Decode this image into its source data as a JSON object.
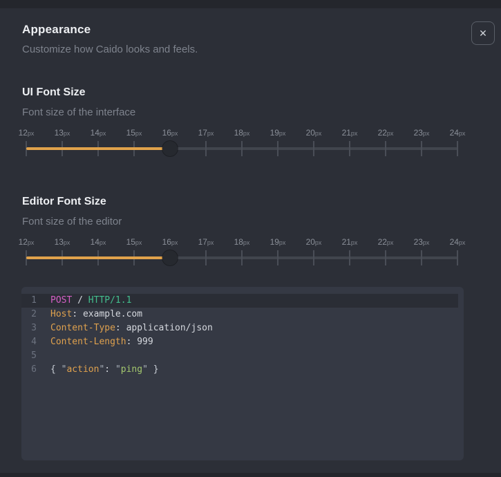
{
  "dialog": {
    "title": "Appearance",
    "subtitle": "Customize how Caido looks and feels.",
    "close_glyph": "✕"
  },
  "sections": [
    {
      "heading": "UI Font Size",
      "description": "Font size of the interface"
    },
    {
      "heading": "Editor Font Size",
      "description": "Font size of the editor"
    }
  ],
  "slider_scale": {
    "min": 12,
    "max": 24,
    "unit": "px",
    "ticks": [
      12,
      13,
      14,
      15,
      16,
      17,
      18,
      19,
      20,
      21,
      22,
      23,
      24
    ]
  },
  "sliders": [
    {
      "name": "ui-font-size",
      "value": 16
    },
    {
      "name": "editor-font-size",
      "value": 16
    }
  ],
  "editor_preview": {
    "lines": [
      {
        "number": 1,
        "active": true,
        "segments": [
          {
            "text": "POST",
            "type": "method"
          },
          {
            "text": " ",
            "type": "plain"
          },
          {
            "text": "/",
            "type": "plain"
          },
          {
            "text": " ",
            "type": "plain"
          },
          {
            "text": "HTTP/1.1",
            "type": "version"
          }
        ]
      },
      {
        "number": 2,
        "active": false,
        "segments": [
          {
            "text": "Host",
            "type": "header_name"
          },
          {
            "text": ": ",
            "type": "plain"
          },
          {
            "text": "example.com",
            "type": "plain"
          }
        ]
      },
      {
        "number": 3,
        "active": false,
        "segments": [
          {
            "text": "Content-Type",
            "type": "header_name"
          },
          {
            "text": ": ",
            "type": "plain"
          },
          {
            "text": "application/json",
            "type": "plain"
          }
        ]
      },
      {
        "number": 4,
        "active": false,
        "segments": [
          {
            "text": "Content-Length",
            "type": "header_name"
          },
          {
            "text": ": ",
            "type": "plain"
          },
          {
            "text": "999",
            "type": "plain"
          }
        ]
      },
      {
        "number": 5,
        "active": false,
        "segments": []
      },
      {
        "number": 6,
        "active": false,
        "segments": [
          {
            "text": "{ ",
            "type": "brace"
          },
          {
            "text": "\"",
            "type": "quote"
          },
          {
            "text": "action",
            "type": "json_key"
          },
          {
            "text": "\"",
            "type": "quote"
          },
          {
            "text": ": ",
            "type": "plain"
          },
          {
            "text": "\"",
            "type": "quote"
          },
          {
            "text": "ping",
            "type": "string"
          },
          {
            "text": "\"",
            "type": "quote"
          },
          {
            "text": " }",
            "type": "brace"
          }
        ]
      }
    ]
  },
  "colors": {
    "accent": "#e0a24b",
    "slider_handle": "#26292f",
    "dialog_bg": "#2c2f37",
    "editor_bg": "#353944",
    "active_line_bg": "#2a2d35",
    "syntax": {
      "method": "#d65fc6",
      "version": "#43bf8e",
      "header_name": "#dfa14e",
      "json_key": "#dfa14e",
      "string": "#a3c76e",
      "quote": "#a9b1ba",
      "brace": "#c9ced6",
      "plain": "#d5d8de"
    }
  }
}
